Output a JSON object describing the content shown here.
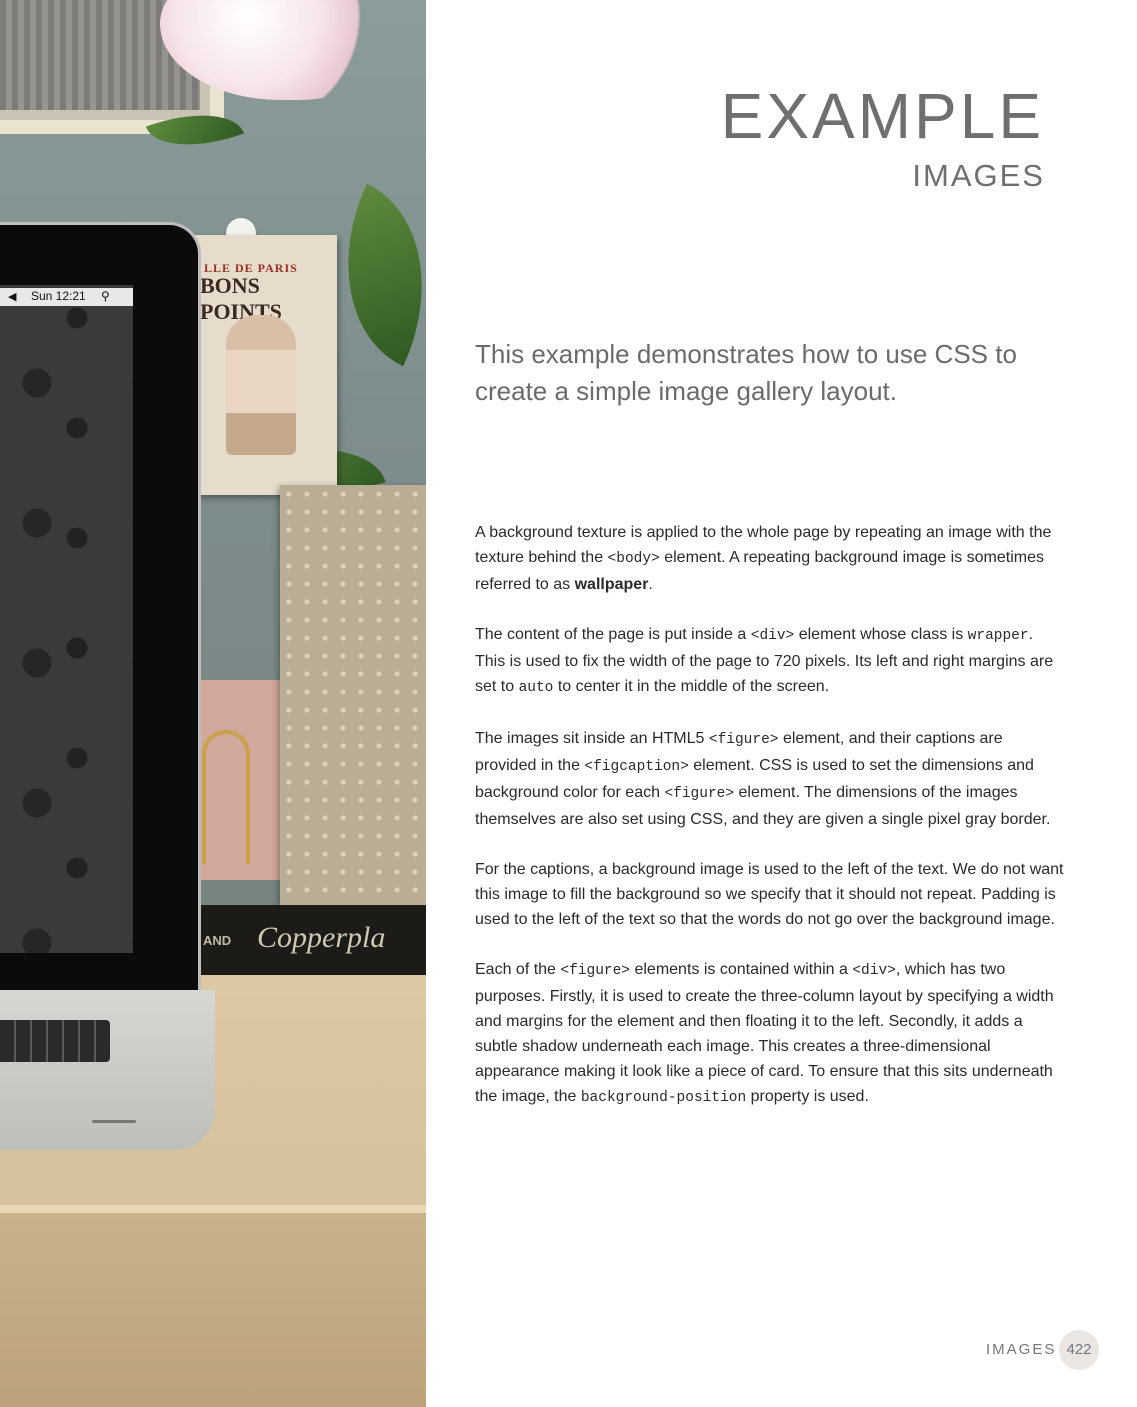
{
  "photo": {
    "menubar_time": "Sun 12:21",
    "poster_top": "LLE DE PARIS",
    "poster_title": "BONS POINTS",
    "book_label": "AND",
    "book_title": "Copperpla"
  },
  "header": {
    "title": "EXAMPLE",
    "subtitle": "IMAGES"
  },
  "intro": "This example demonstrates how to use CSS to create a simple image gallery layout.",
  "paragraphs": {
    "p1": {
      "t1": "A background texture is applied to the whole page by repeating an image with the texture behind the ",
      "c1": "<body>",
      "t2": " element. A repeating background image is sometimes referred to as ",
      "b1": "wallpaper",
      "t3": "."
    },
    "p2": {
      "t1": "The content of the page is put inside a ",
      "c1": "<div>",
      "t2": " element whose class is ",
      "c2": "wrapper",
      "t3": ". This is used to fix the width of the page to 720 pixels. Its left and right margins are set to ",
      "c3": "auto",
      "t4": " to center it in the middle of the screen."
    },
    "p3": {
      "t1": "The images sit inside an HTML5 ",
      "c1": "<figure>",
      "t2": " element, and their captions are provided in the ",
      "c2": "<figcaption>",
      "t3": " element. CSS is used to set the dimensions and background color for each ",
      "c3": "<figure>",
      "t4": " element. The dimensions of the images themselves are also set using CSS, and they are given a single pixel gray border."
    },
    "p4": {
      "t1": "For the captions, a background image is used to the left of the text. We do not want this image to fill the background so we specify that it should not repeat. Padding is used to the left of the text so that the words do not go over the background image."
    },
    "p5": {
      "t1": "Each of the ",
      "c1": "<figure>",
      "t2": " elements is contained within a ",
      "c2": "<div>",
      "t3": ", which has two purposes. Firstly, it is used to create the three-column layout by specifying a width and margins for the element and then floating it to the left. Secondly, it adds a subtle shadow underneath each image. This creates a three-dimensional appearance making it look like a piece of card. To ensure that this sits underneath the image, the ",
      "c3": "background-position",
      "t4": " property is used."
    }
  },
  "footer": {
    "section": "IMAGES",
    "page_number": "422"
  }
}
